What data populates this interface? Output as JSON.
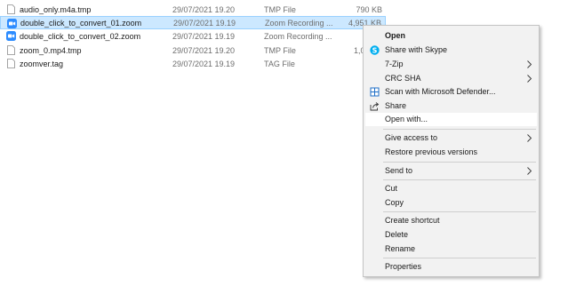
{
  "files": [
    {
      "name": "audio_only.m4a.tmp",
      "date": "29/07/2021 19.20",
      "type": "TMP File",
      "size": "790 KB",
      "icon": "blank-file-icon"
    },
    {
      "name": "double_click_to_convert_01.zoom",
      "date": "29/07/2021 19.19",
      "type": "Zoom Recording ...",
      "size": "4,951 KB",
      "icon": "zoom-icon"
    },
    {
      "name": "double_click_to_convert_02.zoom",
      "date": "29/07/2021 19.19",
      "type": "Zoom Recording ...",
      "size": "",
      "icon": "zoom-icon"
    },
    {
      "name": "zoom_0.mp4.tmp",
      "date": "29/07/2021 19.20",
      "type": "TMP File",
      "size": "1,0",
      "icon": "blank-file-icon"
    },
    {
      "name": "zoomver.tag",
      "date": "29/07/2021 19.19",
      "type": "TAG File",
      "size": "",
      "icon": "blank-file-icon"
    }
  ],
  "context_menu": {
    "open": "Open",
    "share_skype": "Share with Skype",
    "seven_zip": "7-Zip",
    "crc_sha": "CRC SHA",
    "defender": "Scan with Microsoft Defender...",
    "share": "Share",
    "open_with": "Open with...",
    "give_access": "Give access to",
    "restore": "Restore previous versions",
    "send_to": "Send to",
    "cut": "Cut",
    "copy": "Copy",
    "create_shortcut": "Create shortcut",
    "delete": "Delete",
    "rename": "Rename",
    "properties": "Properties"
  },
  "colors": {
    "selection": "#cce8ff",
    "zoom_blue": "#2d8cff",
    "skype_blue": "#00aff0",
    "menu_bg": "#f2f2f2"
  }
}
